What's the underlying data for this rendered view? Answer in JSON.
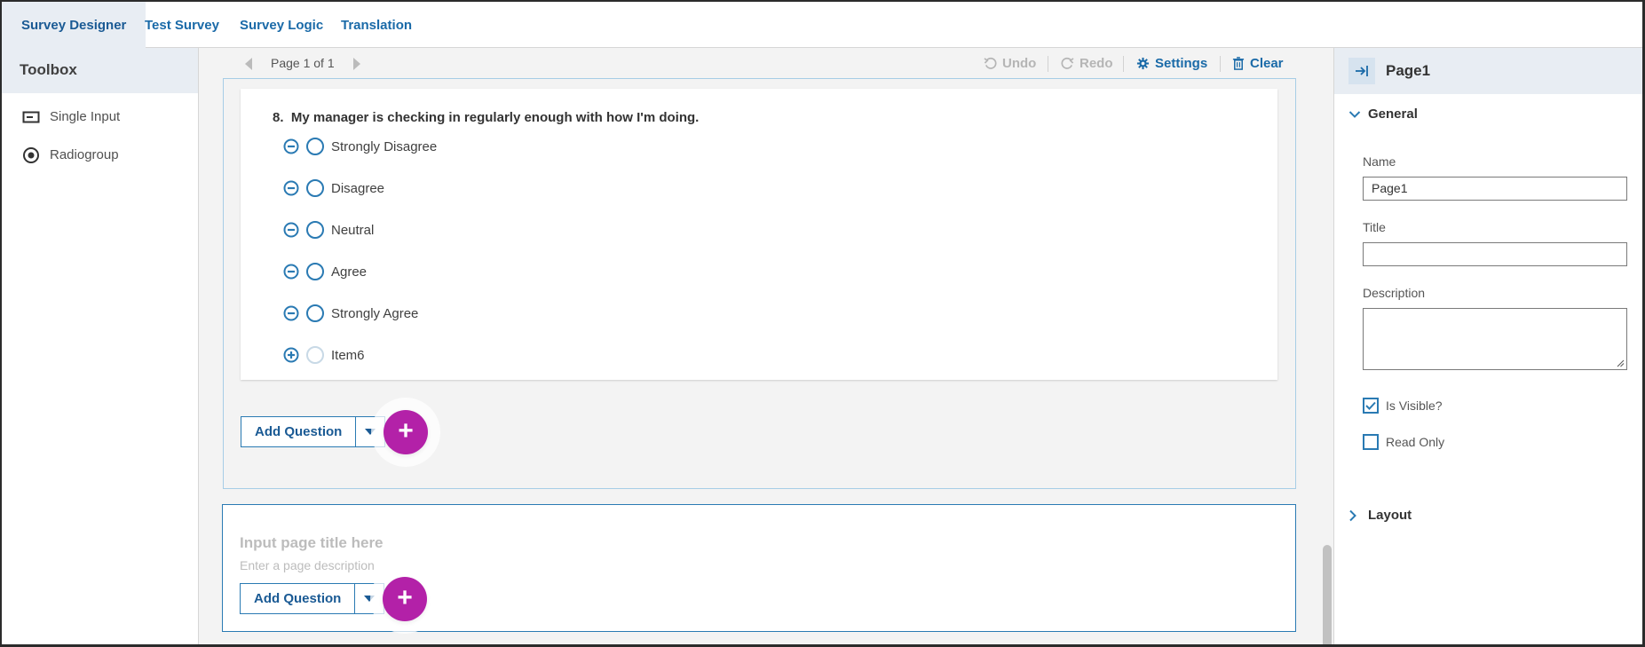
{
  "tabs": [
    "Survey Designer",
    "Test Survey",
    "Survey Logic",
    "Translation"
  ],
  "toolbox": {
    "title": "Toolbox",
    "items": [
      {
        "label": "Single Input",
        "icon": "single-input-icon"
      },
      {
        "label": "Radiogroup",
        "icon": "radiogroup-icon"
      }
    ]
  },
  "toolbar": {
    "page_label": "Page 1 of 1",
    "undo": "Undo",
    "redo": "Redo",
    "settings": "Settings",
    "clear": "Clear"
  },
  "question": {
    "number": "8.",
    "title": "My manager is checking in regularly enough with how I'm doing.",
    "choices": [
      {
        "label": "Strongly Disagree",
        "action": "remove"
      },
      {
        "label": "Disagree",
        "action": "remove"
      },
      {
        "label": "Neutral",
        "action": "remove"
      },
      {
        "label": "Agree",
        "action": "remove"
      },
      {
        "label": "Strongly Agree",
        "action": "remove"
      },
      {
        "label": "Item6",
        "action": "add"
      }
    ]
  },
  "add_question_label": "Add Question",
  "new_page": {
    "title_placeholder": "Input page title here",
    "description_placeholder": "Enter a page description"
  },
  "properties": {
    "object_name": "Page1",
    "general_section": "General",
    "name_label": "Name",
    "name_value": "Page1",
    "title_label": "Title",
    "title_value": "",
    "description_label": "Description",
    "is_visible_label": "Is Visible?",
    "is_visible_checked": true,
    "read_only_label": "Read Only",
    "read_only_checked": false,
    "layout_section": "Layout"
  },
  "colors": {
    "accent": "#1a6aa8",
    "fab": "#b321a8",
    "panel_header": "#e8edf3"
  }
}
